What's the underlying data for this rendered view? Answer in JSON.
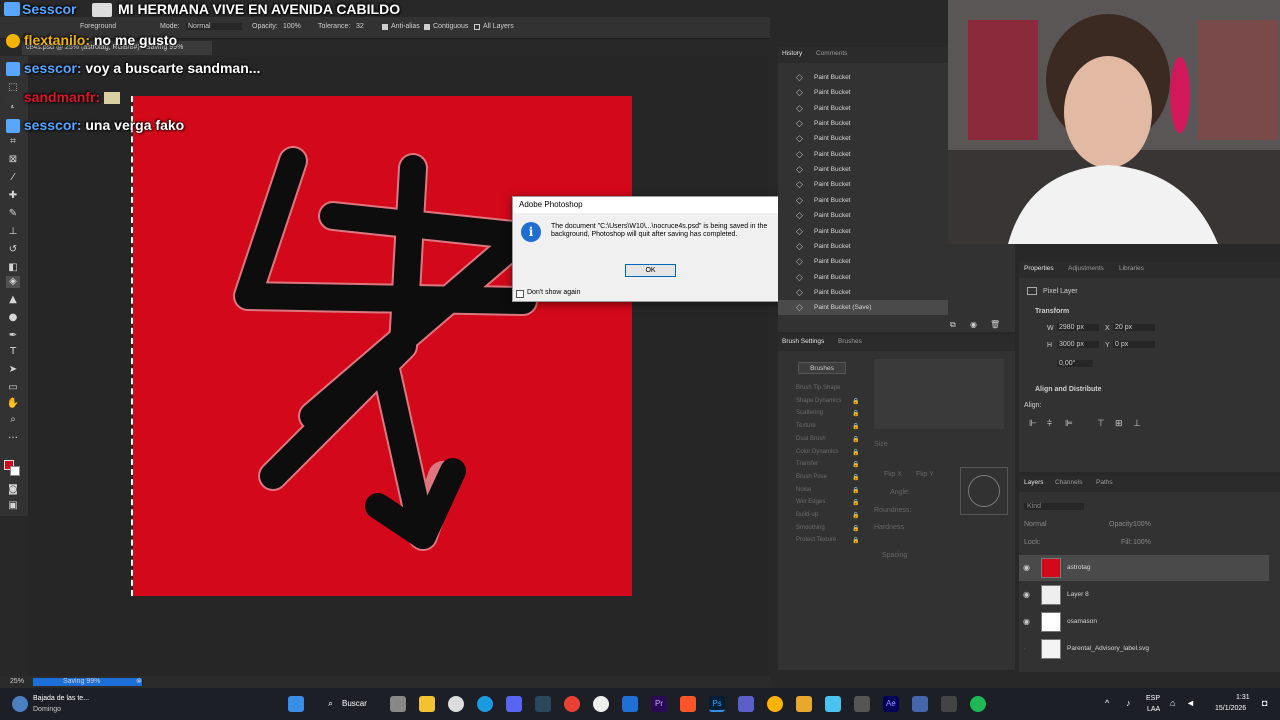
{
  "stream_title": "MI HERMANA VIVE EN AVENIDA CABILDO",
  "stream_title_prefix": "Sesscor",
  "chat": [
    {
      "user": "flextanilo:",
      "message": "no me gusto"
    },
    {
      "user": "sesscor:",
      "message": "voy a buscarte sandman..."
    },
    {
      "user": "sandmanfr:",
      "message": ""
    },
    {
      "user": "sesscor:",
      "message": "una verga fako"
    }
  ],
  "options_bar": {
    "fill_source": "Foreground",
    "mode_label": "Mode:",
    "mode_value": "Normal",
    "opacity_label": "Opacity:",
    "opacity_value": "100%",
    "tolerance_label": "Tolerance:",
    "tolerance_value": "32",
    "anti_alias": "Anti-alias",
    "contiguous": "Contiguous",
    "all_layers": "All Layers"
  },
  "document_tab": "ce4s.psd @ 25% (astrotag, RGB/8#) - Saving 99%",
  "dialog": {
    "title": "Adobe Photoshop",
    "message": "The document \"C:\\Users\\W10\\...\\nocruce4s.psd\" is being saved in the background, Photoshop will quit after saving has completed.",
    "ok": "OK",
    "dont_show": "Don't show again"
  },
  "history": {
    "tabs": [
      "History",
      "Comments"
    ],
    "items": [
      "Paint Bucket",
      "Paint Bucket",
      "Paint Bucket",
      "Paint Bucket",
      "Paint Bucket",
      "Paint Bucket",
      "Paint Bucket",
      "Paint Bucket",
      "Paint Bucket",
      "Paint Bucket",
      "Paint Bucket",
      "Paint Bucket",
      "Paint Bucket",
      "Paint Bucket",
      "Paint Bucket",
      "Paint Bucket (Save)"
    ]
  },
  "brush_settings": {
    "tabs": [
      "Brush Settings",
      "Brushes"
    ],
    "brushes_button": "Brushes",
    "items": [
      "Brush Tip Shape",
      "Shape Dynamics",
      "Scattering",
      "Texture",
      "Dual Brush",
      "Color Dynamics",
      "Transfer",
      "Brush Pose",
      "Noise",
      "Wet Edges",
      "Build-up",
      "Smoothing",
      "Protect Texture"
    ],
    "size_label": "Size",
    "flip_x": "Flip X",
    "flip_y": "Flip Y",
    "angle_label": "Angle:",
    "roundness_label": "Roundness:",
    "hardness_label": "Hardness",
    "spacing_label": "Spacing"
  },
  "properties": {
    "tabs": [
      "Properties",
      "Adjustments",
      "Libraries"
    ],
    "layer_type": "Pixel Layer",
    "transform_label": "Transform",
    "w_label": "W",
    "w_value": "2980 px",
    "h_label": "H",
    "h_value": "3000 px",
    "x_label": "X",
    "x_value": "20 px",
    "y_label": "Y",
    "y_value": "0 px",
    "angle_value": "0,00°",
    "align_label": "Align and Distribute",
    "align_sub": "Align:"
  },
  "layers": {
    "tabs": [
      "Layers",
      "Channels",
      "Paths"
    ],
    "search_placeholder": "Kind",
    "blend_mode": "Normal",
    "opacity_label": "Opacity:",
    "opacity_value": "100%",
    "lock_label": "Lock:",
    "fill_label": "Fill:",
    "fill_value": "100%",
    "items": [
      {
        "name": "astrotag"
      },
      {
        "name": "Layer 8"
      },
      {
        "name": "osamason"
      },
      {
        "name": "Parental_Advisory_label.svg"
      }
    ]
  },
  "status": {
    "zoom": "25%",
    "saving": "Saving 99%"
  },
  "taskbar": {
    "weather_title": "Bajada de las te...",
    "weather_sub": "Domingo",
    "search": "Buscar",
    "lang": "ESP",
    "lang_sub": "LAA",
    "time": "1:31",
    "date": "15/1/2026"
  },
  "colors": {
    "canvas_red": "#d3081a",
    "ps_panel": "#323232",
    "accent_blue": "#1e6fd0"
  }
}
